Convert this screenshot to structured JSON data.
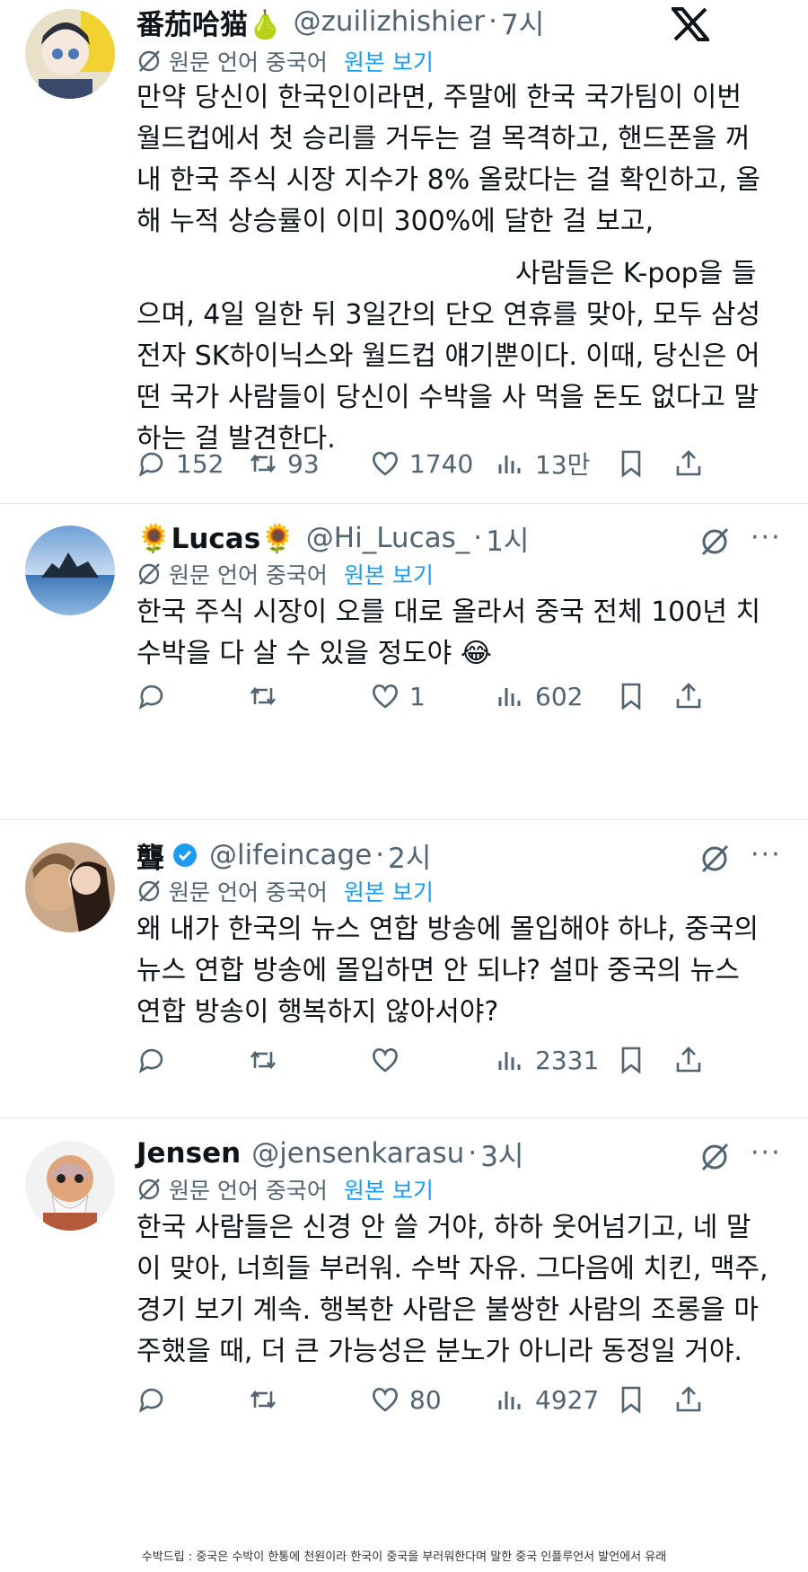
{
  "posts": [
    {
      "name": "番茄哈猫🍐",
      "handle": "@zuilizhishier",
      "time": "7시",
      "translate": {
        "label": "원문 언어 중국어",
        "show_original": "원본 보기"
      },
      "text": "만약 당신이 한국인이라면, 주말에 한국 국가팀이 이번\n월드컵에서 첫 승리를 거두는 걸 목격하고, 핸드폰을 꺼\n내 한국 주식 시장 지수가 8% 올랐다는 걸 확인하고, 올\n해 누적 상승률이 이미 300%에 달한 걸 보고,",
      "text2": "사람들은 K-pop을 들\n으며, 4일 일한 뒤 3일간의 단오 연휴를 맞아, 모두 삼성\n전자 SK하이닉스와 월드컵 얘기뿐이다. 이때, 당신은 어\n떤 국가 사람들이 당신이 수박을 사 먹을 돈도 없다고 말\n하는 걸 발견한다.",
      "stats": {
        "replies": "152",
        "reposts": "93",
        "likes": "1740",
        "views": "13만"
      }
    },
    {
      "name": "🌻Lucas🌻",
      "handle": "@Hi_Lucas_",
      "time": "1시",
      "translate": {
        "label": "원문 언어 중국어",
        "show_original": "원본 보기"
      },
      "text": "한국 주식 시장이 오를 대로 올라서 중국 전체 100년 치\n수박을 다 살 수 있을 정도야 😂",
      "stats": {
        "replies": "",
        "reposts": "",
        "likes": "1",
        "views": "602"
      }
    },
    {
      "name": "聾",
      "handle": "@lifeincage",
      "time": "2시",
      "translate": {
        "label": "원문 언어 중국어",
        "show_original": "원본 보기"
      },
      "text": "왜 내가 한국의 뉴스 연합 방송에 몰입해야 하냐, 중국의\n뉴스 연합 방송에 몰입하면 안 되냐? 설마 중국의 뉴스\n연합 방송이 행복하지 않아서야?",
      "stats": {
        "replies": "",
        "reposts": "",
        "likes": "",
        "views": "2331"
      }
    },
    {
      "name": "Jensen",
      "handle": "@jensenkarasu",
      "time": "3시",
      "translate": {
        "label": "원문 언어 중국어",
        "show_original": "원본 보기"
      },
      "text": "한국 사람들은 신경 안 쓸 거야, 하하 웃어넘기고, 네 말\n이 맞아, 너희들 부러워. 수박 자유. 그다음에 치킨, 맥주,\n경기 보기 계속. 행복한 사람은 불쌍한 사람의 조롱을 마\n주했을 때, 더 큰 가능성은 분노가 아니라 동정일 거야.",
      "stats": {
        "replies": "",
        "reposts": "",
        "likes": "80",
        "views": "4927"
      }
    }
  ],
  "footnote": "수박드립 : 중국은 수박이 한통에 천원이라 한국이 중국을 부러워한다며 말한 중국 인플루언서 발언에서 유래",
  "colors": {
    "text": "#0f1419",
    "muted": "#536471",
    "accent": "#1d9bf0",
    "verified": "#1d9bf0"
  },
  "icons": [
    "x-logo-icon",
    "globe-off-icon",
    "reply-icon",
    "repost-icon",
    "like-icon",
    "views-icon",
    "bookmark-icon",
    "share-icon",
    "more-icon",
    "verified-icon"
  ]
}
